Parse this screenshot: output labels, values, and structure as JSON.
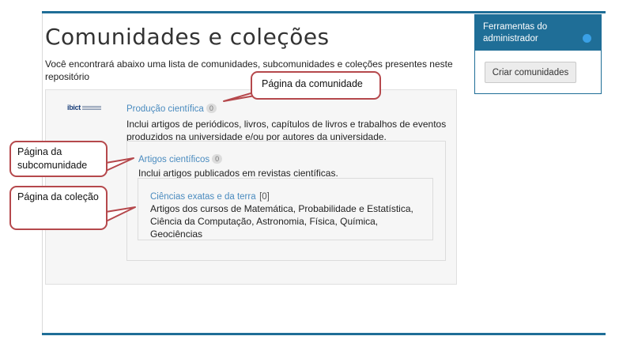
{
  "page": {
    "title": "Comunidades e coleções",
    "intro": "Você encontrará abaixo uma lista de comunidades, subcomunidades e coleções presentes neste repositório"
  },
  "admin": {
    "heading": "Ferramentas do administrador",
    "button_label": "Criar comunidades",
    "accent": "#1f6e97"
  },
  "logo": {
    "mark": "ibict"
  },
  "community": {
    "title": "Produção científica",
    "count": "0",
    "description": "Inclui artigos de periódicos, livros, capítulos de livros e trabalhos de eventos produzidos na universidade e/ou por autores da universidade."
  },
  "subcommunity": {
    "title": "Artigos científicos",
    "count": "0",
    "description": "Inclui artigos publicados em revistas científicas."
  },
  "collection": {
    "title": "Ciências exatas e da terra",
    "count": "[0]",
    "description": "Artigos dos cursos de Matemática, Probabilidade e Estatística, Ciência da Computação, Astronomia, Física, Química, Geociências"
  },
  "callouts": {
    "community": "Página da comunidade",
    "subcommunity": "Página da subcomunidade",
    "collection": "Página da coleção",
    "border_color": "#b5484c"
  }
}
